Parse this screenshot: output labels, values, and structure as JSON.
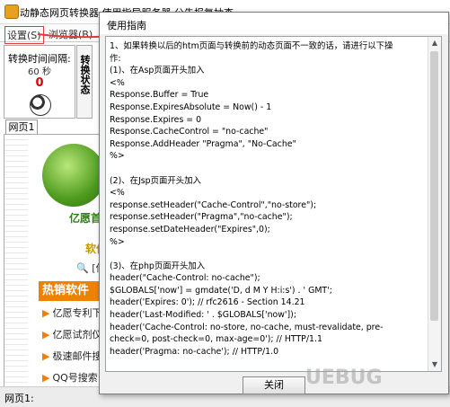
{
  "app": {
    "title": "动静态网页转换器   使用指导服务器  公告报复抽查",
    "menu": [
      "设置(S)",
      "浏览器(B)"
    ],
    "interval_label": "转换时间间隔:",
    "interval_value": "60 秒",
    "countdown": "0",
    "convert_status": "转换状态",
    "tab": "网页1",
    "web": {
      "site_name": "亿愿首",
      "site_sub": "软件",
      "search_fragment": "[亿",
      "hot_title": "热销软件",
      "hot_items": [
        "亿愿专利下载",
        "亿愿试剂仪器",
        "极速邮件搜索",
        "QQ号搜索"
      ]
    },
    "status": "网页1:"
  },
  "dialog": {
    "title": "使用指南",
    "content": "1、如果转换以后的htm页面与转换前的动态页面不一致的话，请进行以下操\n作:\n(1)、在Asp页面开头加入\n<%\nResponse.Buffer = True\nResponse.ExpiresAbsolute = Now() - 1\nResponse.Expires = 0\nResponse.CacheControl = \"no-cache\"\nResponse.AddHeader \"Pragma\", \"No-Cache\"\n%>\n\n(2)、在Jsp页面开头加入\n<%\nresponse.setHeader(\"Cache-Control\",\"no-store\");\nresponse.setHeader(\"Pragma\",\"no-cache\");\nresponse.setDateHeader(\"Expires\",0);\n%>\n\n(3)、在php页面开头加入\nheader(\"Cache-Control: no-cache\");\n$GLOBALS['now'] = gmdate('D, d M Y H:i:s') . ' GMT';\nheader('Expires: 0'); // rfc2616 - Section 14.21\nheader('Last-Modified: ' . $GLOBALS['now']);\nheader('Cache-Control: no-store, no-cache, must-revalidate, pre-\ncheck=0, post-check=0, max-age=0'); // HTTP/1.1\nheader('Pragma: no-cache'); // HTTP/1.0",
    "close_label": "关闭"
  },
  "watermark": "UEBUG",
  "colors": {
    "accent_red": "#e23a3a",
    "hot_orange": "#f08000",
    "site_green": "#2d7f0f"
  }
}
